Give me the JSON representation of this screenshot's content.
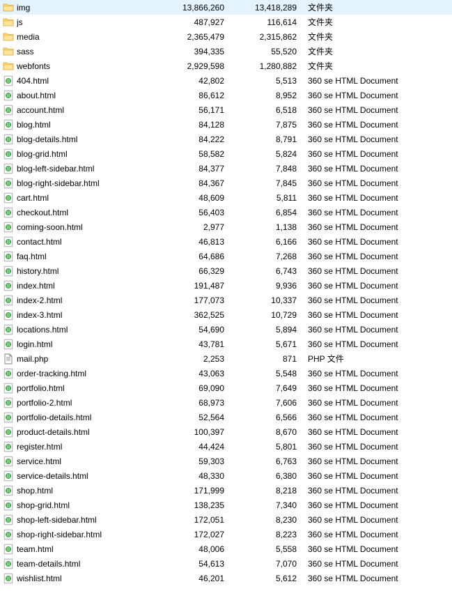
{
  "icons": {
    "folder": "<svg viewBox='0 0 16 16'><path d='M1 3 L6 3 L7.5 4.5 L15 4.5 L15 13 L1 13 Z' fill='#ffe49c' stroke='#d8a43a' stroke-width='0.8'/><path d='M1 3 L6 3 L7.5 4.5 L15 4.5 L15 6 L1 6 Z' fill='#ffd66b' stroke='#d8a43a' stroke-width='0.6'/></svg>",
    "html": "<svg viewBox='0 0 16 16'><rect x='2.2' y='1.2' width='11.6' height='13.6' rx='1' fill='#ffffff' stroke='#9aa0a6' stroke-width='0.9'/><circle cx='8' cy='8' r='3.4' fill='none' stroke='#39a642' stroke-width='1.3'/><path d='M4.7 8 Q8 5.5 11.3 8 Q8 10.5 4.7 8 Z' fill='none' stroke='#39a642' stroke-width='0.9'/><line x1='8' y1='4.6' x2='8' y2='11.4' stroke='#39a642' stroke-width='0.9'/></svg>",
    "generic": "<svg viewBox='0 0 16 16'><path d='M3 1 L10 1 L13 4 L13 15 L3 15 Z' fill='#ffffff' stroke='#7d7d7d' stroke-width='0.9'/><path d='M10 1 L10 4 L13 4' fill='none' stroke='#7d7d7d' stroke-width='0.9'/><line x1='5' y1='6'  x2='11' y2='6'  stroke='#7d7d7d' stroke-width='0.8'/><line x1='5' y1='8'  x2='11' y2='8'  stroke='#7d7d7d' stroke-width='0.8'/><line x1='5' y1='10' x2='11' y2='10' stroke='#7d7d7d' stroke-width='0.8'/></svg>"
  },
  "typeLabels": {
    "folder": "文件夹",
    "html": "360 se HTML Document",
    "php": "PHP 文件"
  },
  "files": [
    {
      "name": "img",
      "size": "13,866,260",
      "csize": "13,418,289",
      "type": "folder",
      "icon": "folder"
    },
    {
      "name": "js",
      "size": "487,927",
      "csize": "116,614",
      "type": "folder",
      "icon": "folder"
    },
    {
      "name": "media",
      "size": "2,365,479",
      "csize": "2,315,862",
      "type": "folder",
      "icon": "folder"
    },
    {
      "name": "sass",
      "size": "394,335",
      "csize": "55,520",
      "type": "folder",
      "icon": "folder"
    },
    {
      "name": "webfonts",
      "size": "2,929,598",
      "csize": "1,280,882",
      "type": "folder",
      "icon": "folder"
    },
    {
      "name": "404.html",
      "size": "42,802",
      "csize": "5,513",
      "type": "html",
      "icon": "html"
    },
    {
      "name": "about.html",
      "size": "86,612",
      "csize": "8,952",
      "type": "html",
      "icon": "html"
    },
    {
      "name": "account.html",
      "size": "56,171",
      "csize": "6,518",
      "type": "html",
      "icon": "html"
    },
    {
      "name": "blog.html",
      "size": "84,128",
      "csize": "7,875",
      "type": "html",
      "icon": "html"
    },
    {
      "name": "blog-details.html",
      "size": "84,222",
      "csize": "8,791",
      "type": "html",
      "icon": "html"
    },
    {
      "name": "blog-grid.html",
      "size": "58,582",
      "csize": "5,824",
      "type": "html",
      "icon": "html"
    },
    {
      "name": "blog-left-sidebar.html",
      "size": "84,377",
      "csize": "7,848",
      "type": "html",
      "icon": "html"
    },
    {
      "name": "blog-right-sidebar.html",
      "size": "84,367",
      "csize": "7,845",
      "type": "html",
      "icon": "html"
    },
    {
      "name": "cart.html",
      "size": "48,609",
      "csize": "5,811",
      "type": "html",
      "icon": "html"
    },
    {
      "name": "checkout.html",
      "size": "56,403",
      "csize": "6,854",
      "type": "html",
      "icon": "html"
    },
    {
      "name": "coming-soon.html",
      "size": "2,977",
      "csize": "1,138",
      "type": "html",
      "icon": "html"
    },
    {
      "name": "contact.html",
      "size": "46,813",
      "csize": "6,166",
      "type": "html",
      "icon": "html"
    },
    {
      "name": "faq.html",
      "size": "64,686",
      "csize": "7,268",
      "type": "html",
      "icon": "html"
    },
    {
      "name": "history.html",
      "size": "66,329",
      "csize": "6,743",
      "type": "html",
      "icon": "html"
    },
    {
      "name": "index.html",
      "size": "191,487",
      "csize": "9,936",
      "type": "html",
      "icon": "html"
    },
    {
      "name": "index-2.html",
      "size": "177,073",
      "csize": "10,337",
      "type": "html",
      "icon": "html"
    },
    {
      "name": "index-3.html",
      "size": "362,525",
      "csize": "10,729",
      "type": "html",
      "icon": "html"
    },
    {
      "name": "locations.html",
      "size": "54,690",
      "csize": "5,894",
      "type": "html",
      "icon": "html"
    },
    {
      "name": "login.html",
      "size": "43,781",
      "csize": "5,671",
      "type": "html",
      "icon": "html"
    },
    {
      "name": "mail.php",
      "size": "2,253",
      "csize": "871",
      "type": "php",
      "icon": "generic"
    },
    {
      "name": "order-tracking.html",
      "size": "43,063",
      "csize": "5,548",
      "type": "html",
      "icon": "html"
    },
    {
      "name": "portfolio.html",
      "size": "69,090",
      "csize": "7,649",
      "type": "html",
      "icon": "html"
    },
    {
      "name": "portfolio-2.html",
      "size": "68,973",
      "csize": "7,606",
      "type": "html",
      "icon": "html"
    },
    {
      "name": "portfolio-details.html",
      "size": "52,564",
      "csize": "6,566",
      "type": "html",
      "icon": "html"
    },
    {
      "name": "product-details.html",
      "size": "100,397",
      "csize": "8,670",
      "type": "html",
      "icon": "html"
    },
    {
      "name": "register.html",
      "size": "44,424",
      "csize": "5,801",
      "type": "html",
      "icon": "html"
    },
    {
      "name": "service.html",
      "size": "59,303",
      "csize": "6,763",
      "type": "html",
      "icon": "html"
    },
    {
      "name": "service-details.html",
      "size": "48,330",
      "csize": "6,380",
      "type": "html",
      "icon": "html"
    },
    {
      "name": "shop.html",
      "size": "171,999",
      "csize": "8,218",
      "type": "html",
      "icon": "html"
    },
    {
      "name": "shop-grid.html",
      "size": "138,235",
      "csize": "7,340",
      "type": "html",
      "icon": "html"
    },
    {
      "name": "shop-left-sidebar.html",
      "size": "172,051",
      "csize": "8,230",
      "type": "html",
      "icon": "html"
    },
    {
      "name": "shop-right-sidebar.html",
      "size": "172,027",
      "csize": "8,223",
      "type": "html",
      "icon": "html"
    },
    {
      "name": "team.html",
      "size": "48,006",
      "csize": "5,558",
      "type": "html",
      "icon": "html"
    },
    {
      "name": "team-details.html",
      "size": "54,613",
      "csize": "7,070",
      "type": "html",
      "icon": "html"
    },
    {
      "name": "wishlist.html",
      "size": "46,201",
      "csize": "5,612",
      "type": "html",
      "icon": "html"
    }
  ]
}
